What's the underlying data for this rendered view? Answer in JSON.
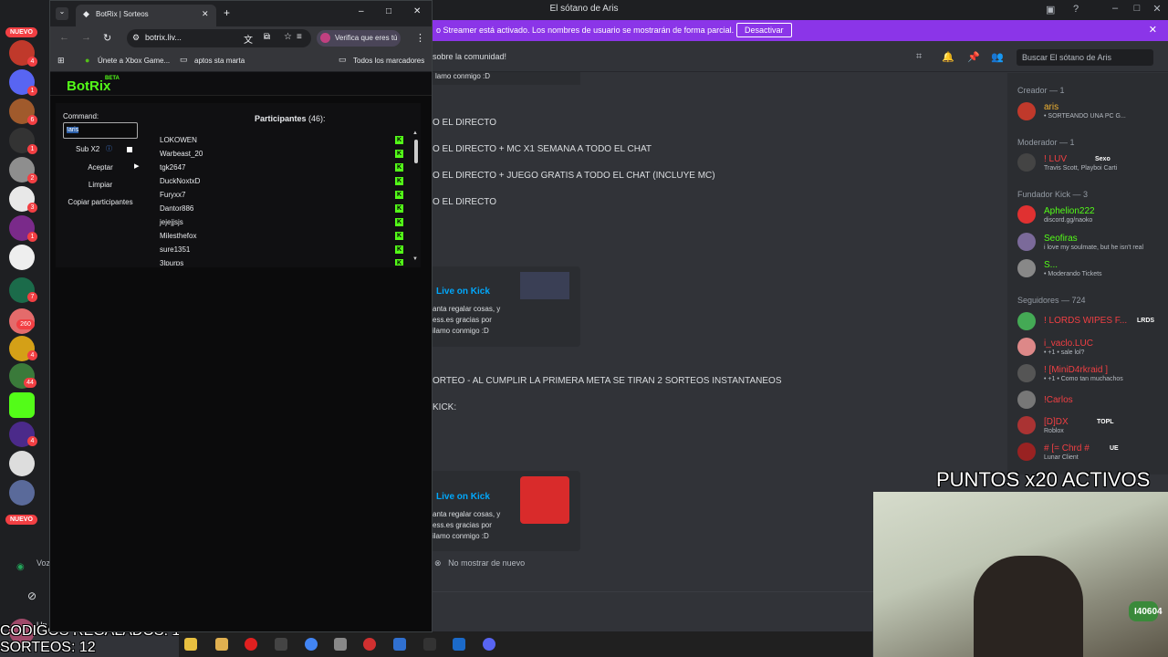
{
  "discord": {
    "title": "El sótano de Aris",
    "streamer_bar": {
      "text": "o Streamer está activado. Los nombres de usuario se mostrarán de forma parcial.",
      "button": "Desactivar"
    },
    "header": {
      "topic": "sobre la comunidad!",
      "search_placeholder": "Buscar El sótano de Aris"
    },
    "messages": [
      {
        "text": "O EL DIRECTO"
      },
      {
        "text": "O EL DIRECTO + MC X1 SEMANA A TODO EL CHAT"
      },
      {
        "text": "O EL DIRECTO + JUEGO GRATIS A TODO EL CHAT (INCLUYE MC)"
      },
      {
        "text": "O EL DIRECTO"
      },
      {
        "text": "ORTEO - AL CUMPLIR LA PRIMERA META SE TIRAN 2 SORTEOS INSTANTANEOS"
      },
      {
        "text": "KICK:"
      }
    ],
    "embeds": [
      {
        "title": "Live on Kick",
        "desc1": "anta regalar cosas, y",
        "desc2": "ess.es gracias por",
        "desc3": "ilamo conmigo :D"
      },
      {
        "title": "Live on Kick",
        "desc1": "anta regalar cosas, y",
        "desc2": "ess.es gracias por",
        "desc3": "ilamo conmigo :D"
      }
    ],
    "top_partial": "lamo conmigo :D",
    "no_mostrar": "No mostrar de nuevo",
    "guild_badges": [
      "NUEVO",
      "4",
      "1",
      "6",
      "1",
      "2",
      "3",
      "1",
      "7",
      "260",
      "4",
      "44",
      "1",
      "4",
      "NUEVO"
    ],
    "guild_side_labels": [
      "Voz",
      "Un"
    ],
    "members": {
      "categories": [
        "Creador — 1",
        "Moderador — 1",
        "Fundador Kick — 3",
        "Seguidores — 724"
      ],
      "creador": [
        {
          "name": "aris",
          "sub": "• SORTEANDO UNA PC G..."
        }
      ],
      "moderador": [
        {
          "name": "! LUV",
          "tag": "Sexo",
          "sub": "Travis Scott, Playboi Carti"
        }
      ],
      "fundador": [
        {
          "name": "Aphelion222",
          "sub": "discord.gg/naoko"
        },
        {
          "name": "Seofiras",
          "sub": "i love my soulmate, but he isn't real"
        },
        {
          "name": "S...",
          "sub": "• Moderando Tickets"
        }
      ],
      "seguidores": [
        {
          "name": "! LORDS WIPES F...",
          "tag": "LRDS",
          "sub": ""
        },
        {
          "name": "i_vaclo.LUC",
          "tag": "",
          "sub": "• +1 • sale lol?"
        },
        {
          "name": "! [MiniD4rkraid ]",
          "tag": "",
          "sub": "• +1 • Como tan muchachos"
        },
        {
          "name": "!Carlos",
          "tag": "",
          "sub": ""
        },
        {
          "name": "[D]DX",
          "tag": "TOPL",
          "sub": "Roblox"
        },
        {
          "name": "# [= Chrd #",
          "tag": "UE",
          "sub": "Lunar Client"
        }
      ]
    }
  },
  "overlay": {
    "puntos": "PUNTOS x20 ACTIVOS",
    "codigos": "CODIGOS REGALADOS: 1",
    "sorteos": "SORTEOS: 12",
    "webcam_label": "I40604"
  },
  "chrome": {
    "tab_title": "BotRix | Sorteos",
    "url": "botrix.liv...",
    "verifica": "Verifica que eres tú",
    "bookmarks": [
      "Únete a Xbox Game...",
      "aptos sta marta",
      "Todos los marcadores"
    ]
  },
  "botrix": {
    "logo": "BotRix",
    "beta": "BETA",
    "command_label": "Command:",
    "command_value": "!aris",
    "sub_x2": "Sub X2",
    "aceptar": "Aceptar",
    "limpiar": "Limpiar",
    "copiar": "Copiar participantes",
    "participantes_label": "Participantes",
    "participantes_count": "(46):",
    "participants": [
      "LOKOWEN",
      "Warbeast_20",
      "tgk2647",
      "DuckNoxtxD",
      "Furyxx7",
      "Dantor886",
      "jejejjsjs",
      "Milesthefox",
      "sure1351",
      "3lpurps"
    ],
    "kick_glyph": "K"
  },
  "colors": {
    "kick_green": "#53fc18",
    "discord_purple": "#8b35e8",
    "discord_bg": "#313338",
    "link_blue": "#00a8fc"
  }
}
